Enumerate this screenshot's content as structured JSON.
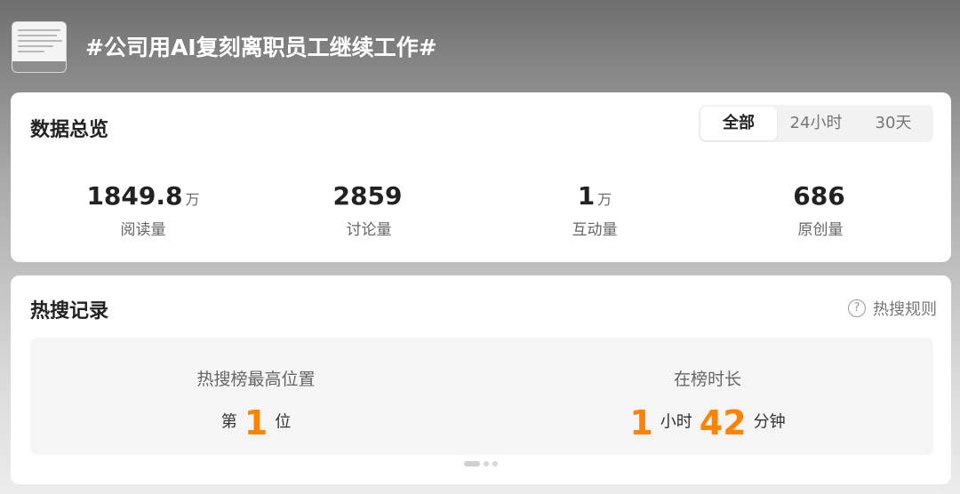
{
  "header": {
    "thumbnail_icon": "post-screenshot-thumbnail",
    "title": "#公司用AI复刻离职员工继续工作#"
  },
  "overview": {
    "title": "数据总览",
    "tabs": [
      {
        "label": "全部",
        "active": true
      },
      {
        "label": "24小时",
        "active": false
      },
      {
        "label": "30天",
        "active": false
      }
    ],
    "stats": [
      {
        "value": "1849.8",
        "unit": "万",
        "label": "阅读量"
      },
      {
        "value": "2859",
        "unit": "",
        "label": "讨论量"
      },
      {
        "value": "1",
        "unit": "万",
        "label": "互动量"
      },
      {
        "value": "686",
        "unit": "",
        "label": "原创量"
      }
    ]
  },
  "hot_search": {
    "title": "热搜记录",
    "rules_label": "热搜规则",
    "help_icon": "question-circle-icon",
    "highest_position": {
      "label": "热搜榜最高位置",
      "prefix": "第",
      "value": "1",
      "suffix": "位"
    },
    "duration": {
      "label": "在榜时长",
      "hours": "1",
      "hours_unit": "小时",
      "minutes": "42",
      "minutes_unit": "分钟"
    },
    "pagination": {
      "pages": 3,
      "current": 1
    }
  },
  "colors": {
    "accent": "#ff8200",
    "card_bg": "#ffffff",
    "inner_bg": "#f5f5f5"
  }
}
